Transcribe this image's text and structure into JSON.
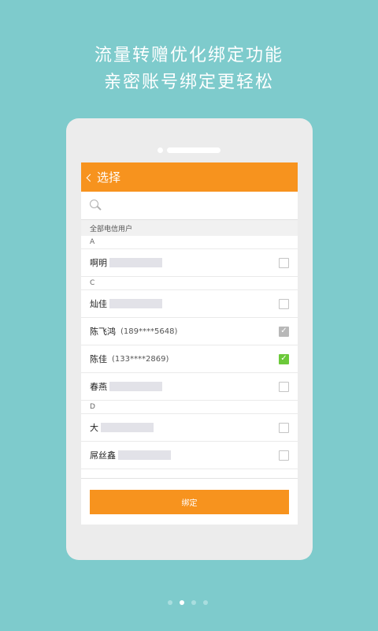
{
  "promo": {
    "line1": "流量转赠优化绑定功能",
    "line2": "亲密账号绑定更轻松"
  },
  "screen": {
    "title": "选择",
    "search_placeholder": "",
    "group_label": "全部电信用户",
    "sections": [
      {
        "letter": "A",
        "contacts": [
          {
            "name": "啊明",
            "phone": "",
            "checked": "none"
          }
        ]
      },
      {
        "letter": "C",
        "contacts": [
          {
            "name": "灿佳",
            "phone": "",
            "checked": "none"
          },
          {
            "name": "陈飞鸿",
            "phone": "(189****5648)",
            "checked": "disabled"
          },
          {
            "name": "陈佳",
            "phone": "(133****2869)",
            "checked": "checked"
          },
          {
            "name": "春燕",
            "phone": "",
            "checked": "none"
          }
        ]
      },
      {
        "letter": "D",
        "contacts": [
          {
            "name": "大",
            "phone": "",
            "checked": "none"
          },
          {
            "name": "屌丝鑫",
            "phone": "",
            "checked": "none"
          }
        ]
      }
    ],
    "bind_label": "绑定"
  },
  "pager": {
    "total": 4,
    "active_index": 1
  },
  "colors": {
    "background": "#7ecbcc",
    "accent": "#f7931e",
    "check_green": "#6cc93a",
    "check_grey": "#b8b8b8"
  }
}
